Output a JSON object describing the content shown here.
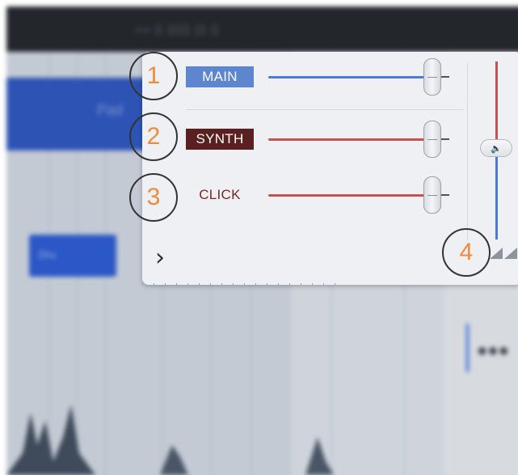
{
  "background": {
    "topbar_text": "«»  ||  ||||||  |||  ||",
    "track_label": "Pad",
    "clip_label": "Dru"
  },
  "mixer": {
    "channels": [
      {
        "label": "MAIN",
        "label_bg": "#5d86cf",
        "label_color": "#ffffff",
        "fader_color": "#4a7bd0",
        "level": 0.95
      },
      {
        "label": "SYNTH",
        "label_bg": "#5a1f1f",
        "label_color": "#ffffff",
        "fader_color": "#c45252",
        "level": 0.95
      },
      {
        "label": "CLICK",
        "label_bg": "transparent",
        "label_color": "#7a2727",
        "fader_color": "#c45252",
        "level": 0.95
      }
    ],
    "master_volume_icon": "speaker-icon",
    "master_volume_glyph": "🔈",
    "expand_glyph": "›",
    "expand_icon": "chevron-right-icon",
    "resize_icon": "resize-grip-icon"
  },
  "callouts": {
    "one": "1",
    "two": "2",
    "three": "3",
    "four": "4",
    "color": "#f08a3c"
  }
}
